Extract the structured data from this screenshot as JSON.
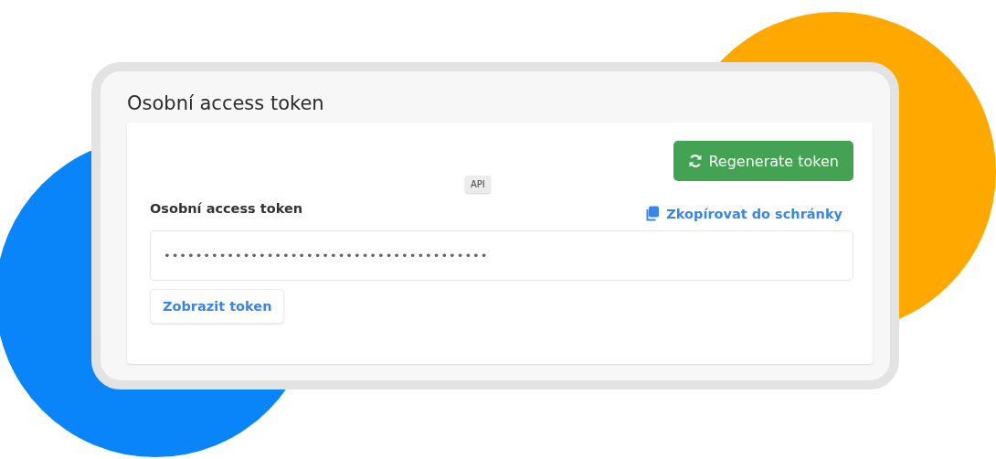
{
  "panel": {
    "title": "Osobní access token"
  },
  "regenerate_button": {
    "label": "Regenerate token"
  },
  "tooltip": {
    "label": "API"
  },
  "token_field": {
    "label": "Osobní access token",
    "value": "•••••••••••••••••••••••••••••••••••••••••"
  },
  "copy_link": {
    "label": "Zkopírovat do schránky"
  },
  "show_button": {
    "label": "Zobrazit token"
  }
}
